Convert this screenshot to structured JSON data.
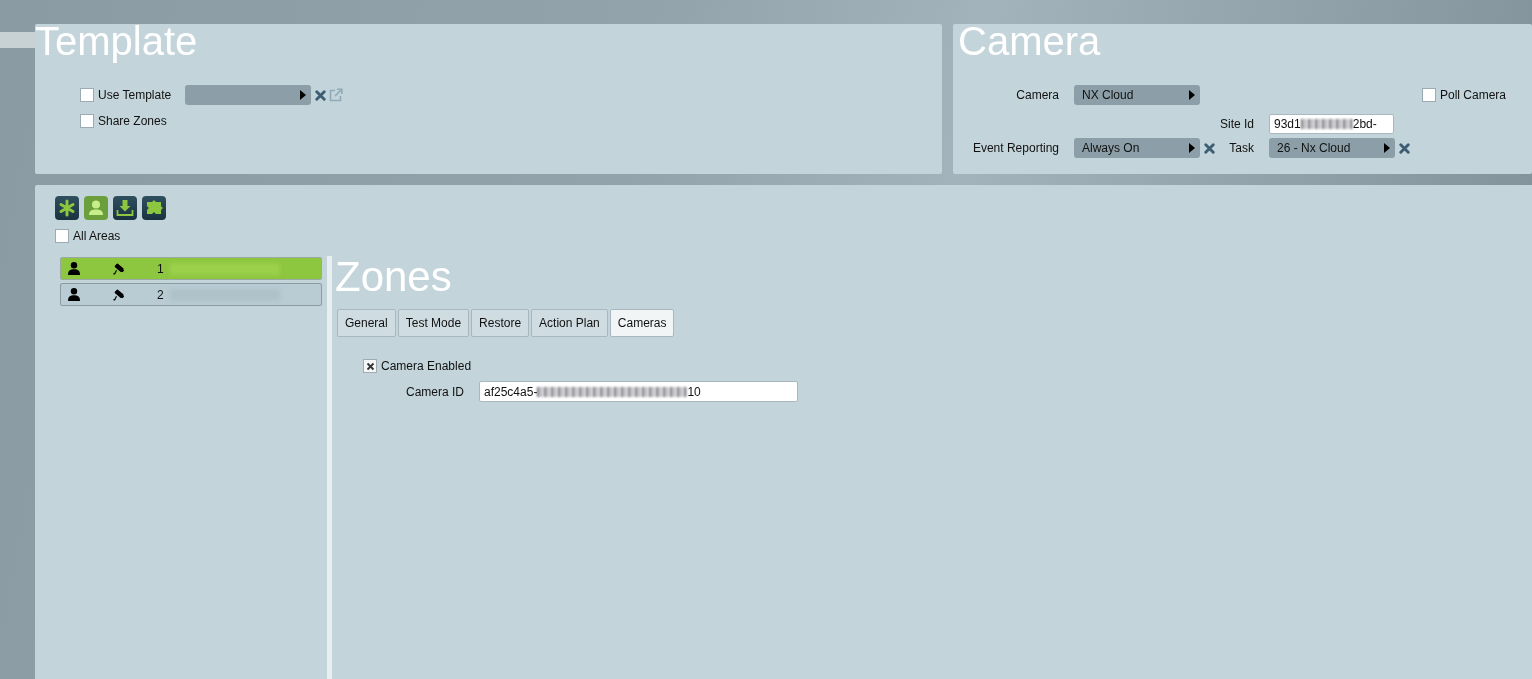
{
  "template": {
    "title": "Template",
    "checkboxes": [
      {
        "label": "Use Template",
        "checked": false
      },
      {
        "label": "Share Zones",
        "checked": false
      }
    ]
  },
  "camera": {
    "title": "Camera",
    "camera_label": "Camera",
    "camera_value": "NX Cloud",
    "poll_camera": {
      "label": "Poll Camera",
      "checked": false
    },
    "site_id_label": "Site Id",
    "site_id_value_start": "93d1",
    "site_id_value_end": "2bd-",
    "event_reporting_label": "Event Reporting",
    "event_reporting_value": "Always On",
    "task_label": "Task",
    "task_value": "26 - Nx Cloud"
  },
  "toolbar": [
    {
      "selected": false
    },
    {
      "selected": true
    },
    {
      "selected": false
    },
    {
      "selected": false
    }
  ],
  "all_areas": {
    "label": "All Areas",
    "checked": false
  },
  "zone_list": [
    {
      "number": "1",
      "selected": true
    },
    {
      "number": "2",
      "selected": false
    }
  ],
  "zones": {
    "title": "Zones",
    "tabs": [
      {
        "label": "General",
        "selected": false
      },
      {
        "label": "Test Mode",
        "selected": false
      },
      {
        "label": "Restore",
        "selected": false
      },
      {
        "label": "Action Plan",
        "selected": false
      },
      {
        "label": "Cameras",
        "selected": true
      }
    ],
    "camera_enabled": {
      "label": "Camera Enabled",
      "checked": true
    },
    "camera_id_label": "Camera ID",
    "camera_id_value_start": "af25c4a5-",
    "camera_id_value_end": "10"
  }
}
